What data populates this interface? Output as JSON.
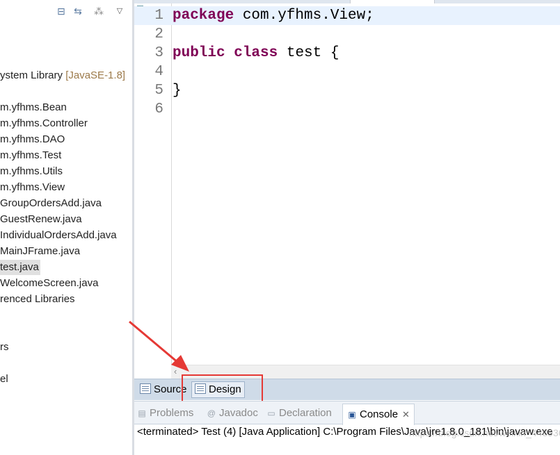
{
  "explorer": {
    "items": [
      {
        "text": "ystem Library ",
        "decoration": "[JavaSE-1.8]"
      },
      {
        "text": "m.yfhms.Bean"
      },
      {
        "text": "m.yfhms.Controller"
      },
      {
        "text": "m.yfhms.DAO"
      },
      {
        "text": "m.yfhms.Test"
      },
      {
        "text": "m.yfhms.Utils"
      },
      {
        "text": "m.yfhms.View"
      },
      {
        "text": "GroupOrdersAdd.java"
      },
      {
        "text": "GuestRenew.java"
      },
      {
        "text": "IndividualOrdersAdd.java"
      },
      {
        "text": "MainJFrame.java"
      },
      {
        "text": "test.java"
      },
      {
        "text": "WelcomeScreen.java"
      },
      {
        "text": "renced Libraries"
      },
      {
        "text": "rs"
      },
      {
        "text": "el"
      }
    ]
  },
  "editor": {
    "lines": [
      {
        "no": "1",
        "keyword": "package",
        "rest": " com.yfhms.View;"
      },
      {
        "no": "2",
        "keyword": "",
        "rest": ""
      },
      {
        "no": "3",
        "keyword": "public class",
        "rest": " test {"
      },
      {
        "no": "4",
        "keyword": "",
        "rest": ""
      },
      {
        "no": "5",
        "keyword": "",
        "rest": "}"
      },
      {
        "no": "6",
        "keyword": "",
        "rest": ""
      }
    ]
  },
  "editor_tabs": {
    "source": "Source",
    "design": "Design"
  },
  "bottom_tabs": {
    "problems": "Problems",
    "javadoc": "Javadoc",
    "declaration": "Declaration",
    "console": "Console"
  },
  "console": {
    "output": "<terminated> Test (4) [Java Application] C:\\Program Files\\Java\\jre1.8.0_181\\bin\\javaw.exe",
    "watermark": "https://blog.csdn.net/weixin_44893602"
  },
  "colors": {
    "keyword": "#7f0055",
    "annotation": "#e53935",
    "current_line": "#e8f2fe"
  }
}
